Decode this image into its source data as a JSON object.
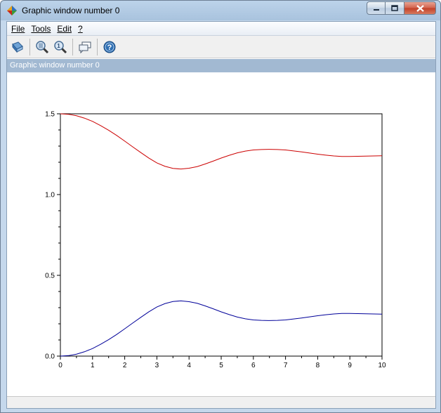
{
  "window": {
    "title": "Graphic window number 0",
    "icons": [
      "scilab-logo-icon",
      "minimize-icon",
      "maximize-icon",
      "close-icon"
    ]
  },
  "menubar": {
    "items": [
      {
        "label": "File"
      },
      {
        "label": "Tools"
      },
      {
        "label": "Edit"
      },
      {
        "label": "?"
      }
    ]
  },
  "toolbar": {
    "buttons": [
      {
        "icon": "rotate-icon"
      },
      {
        "icon": "zoom-icon"
      },
      {
        "icon": "unzoom-icon"
      },
      {
        "icon": "datatip-icon"
      },
      {
        "icon": "help-icon"
      }
    ]
  },
  "banner": {
    "label": "Graphic window number 0"
  },
  "colors": {
    "series1": "#cc0000",
    "series2": "#000099",
    "banner": "#a2b9d2"
  },
  "chart_data": {
    "type": "line",
    "xlim": [
      0,
      10
    ],
    "ylim": [
      0,
      1.5
    ],
    "xticks": [
      "0",
      "1",
      "2",
      "3",
      "4",
      "5",
      "6",
      "7",
      "8",
      "9",
      "10"
    ],
    "yticks": [
      "0.0",
      "0.5",
      "1.0",
      "1.5"
    ],
    "grid": false,
    "series": [
      {
        "color": "#cc0000",
        "x": [
          0,
          0.25,
          0.5,
          0.75,
          1,
          1.25,
          1.5,
          1.75,
          2,
          2.25,
          2.5,
          2.75,
          3,
          3.25,
          3.5,
          3.75,
          4,
          4.25,
          4.5,
          4.75,
          5,
          5.25,
          5.5,
          5.75,
          6,
          6.25,
          6.5,
          6.75,
          7,
          7.25,
          7.5,
          7.75,
          8,
          8.25,
          8.5,
          8.75,
          9,
          9.25,
          9.5,
          9.75,
          10
        ],
        "y": [
          1.5,
          1.497,
          1.488,
          1.473,
          1.453,
          1.427,
          1.398,
          1.366,
          1.331,
          1.295,
          1.26,
          1.226,
          1.196,
          1.175,
          1.162,
          1.158,
          1.163,
          1.173,
          1.189,
          1.207,
          1.226,
          1.243,
          1.258,
          1.269,
          1.276,
          1.279,
          1.28,
          1.279,
          1.276,
          1.27,
          1.264,
          1.257,
          1.25,
          1.244,
          1.239,
          1.236,
          1.236,
          1.237,
          1.238,
          1.239,
          1.24
        ]
      },
      {
        "color": "#000099",
        "x": [
          0,
          0.25,
          0.5,
          0.75,
          1,
          1.25,
          1.5,
          1.75,
          2,
          2.25,
          2.5,
          2.75,
          3,
          3.25,
          3.5,
          3.75,
          4,
          4.25,
          4.5,
          4.75,
          5,
          5.25,
          5.5,
          5.75,
          6,
          6.25,
          6.5,
          6.75,
          7,
          7.25,
          7.5,
          7.75,
          8,
          8.25,
          8.5,
          8.75,
          9,
          9.25,
          9.5,
          9.75,
          10
        ],
        "y": [
          0,
          0.003,
          0.012,
          0.027,
          0.047,
          0.073,
          0.102,
          0.134,
          0.169,
          0.205,
          0.24,
          0.274,
          0.304,
          0.325,
          0.338,
          0.342,
          0.337,
          0.327,
          0.311,
          0.293,
          0.274,
          0.257,
          0.242,
          0.231,
          0.224,
          0.221,
          0.22,
          0.221,
          0.224,
          0.23,
          0.236,
          0.243,
          0.25,
          0.256,
          0.261,
          0.264,
          0.264,
          0.263,
          0.262,
          0.261,
          0.26
        ]
      }
    ]
  }
}
